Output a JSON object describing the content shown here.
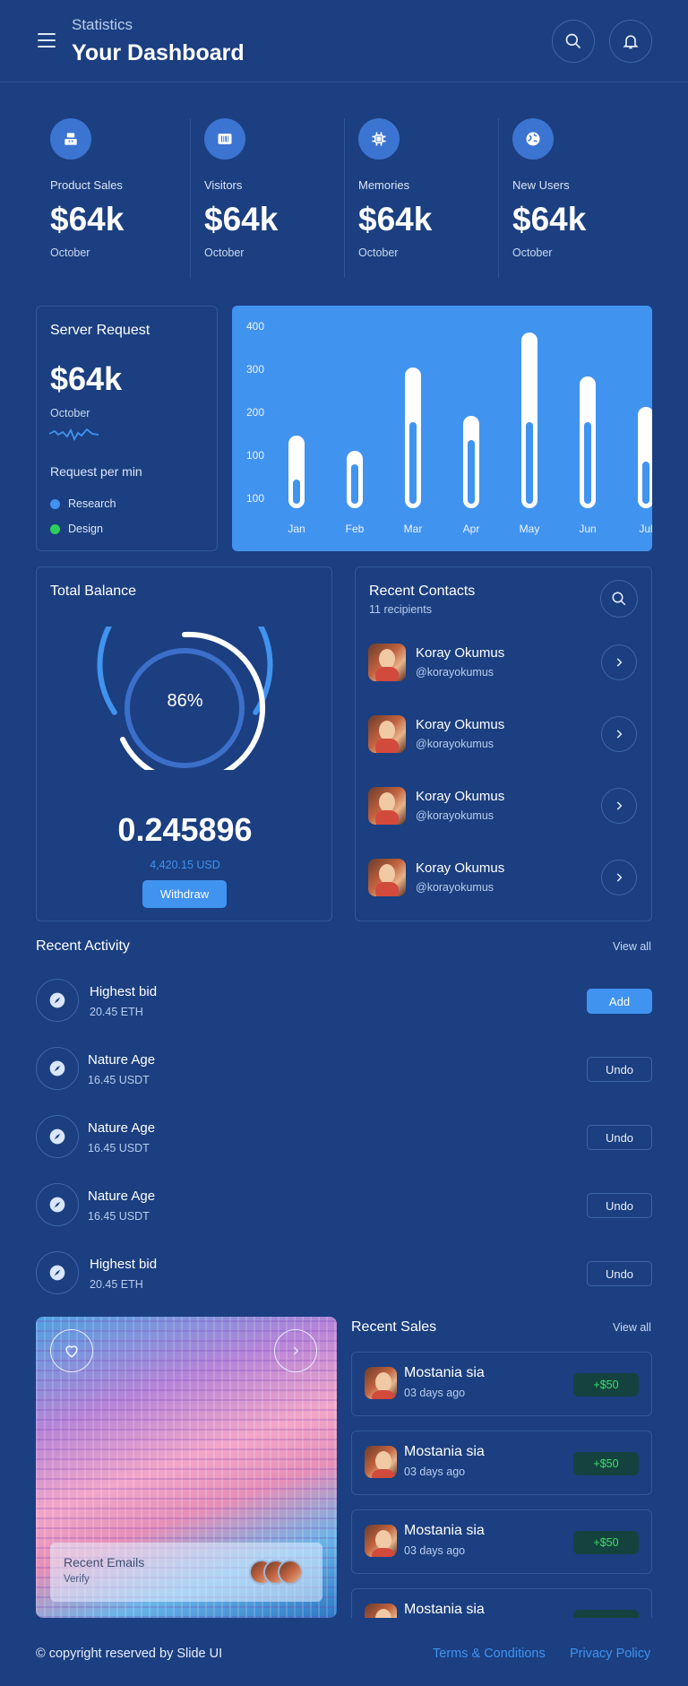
{
  "header": {
    "subtitle": "Statistics",
    "title": "Your Dashboard"
  },
  "stats": [
    {
      "label": "Product Sales",
      "value": "$64k",
      "period": "October",
      "icon": "cash-register-icon"
    },
    {
      "label": "Visitors",
      "value": "$64k",
      "period": "October",
      "icon": "barcode-icon"
    },
    {
      "label": "Memories",
      "value": "$64k",
      "period": "October",
      "icon": "chip-icon"
    },
    {
      "label": "New Users",
      "value": "$64k",
      "period": "October",
      "icon": "globe-icon"
    }
  ],
  "server": {
    "title": "Server Request",
    "value": "$64k",
    "period": "October",
    "subtitle": "Request per min",
    "legend": [
      {
        "label": "Research",
        "color": "#4193f0"
      },
      {
        "label": "Design",
        "color": "#2fcf5c"
      }
    ]
  },
  "chart_data": {
    "type": "bar",
    "categories": [
      "Jan",
      "Feb",
      "Mar",
      "Apr",
      "May",
      "Jun",
      "Jul"
    ],
    "series": [
      {
        "values": [
          165,
          130,
          320,
          210,
          400,
          300,
          230
        ]
      },
      {
        "values": [
          55,
          90,
          185,
          145,
          185,
          185,
          95
        ]
      }
    ],
    "y_tick_labels": [
      "400",
      "300",
      "200",
      "100",
      "100"
    ],
    "ylim": [
      0,
      400
    ],
    "bar_color": "#ffffff",
    "background": "#4193f0"
  },
  "balance": {
    "title": "Total Balance",
    "percent_label": "86%",
    "percent": 0.86,
    "amount": "0.245896",
    "usd": "4,420.15 USD",
    "button": "Withdraw"
  },
  "contacts": {
    "title": "Recent Contacts",
    "subtitle": "11 recipients",
    "items": [
      {
        "name": "Koray Okumus",
        "handle": "@korayokumus"
      },
      {
        "name": "Koray Okumus",
        "handle": "@korayokumus"
      },
      {
        "name": "Koray Okumus",
        "handle": "@korayokumus"
      },
      {
        "name": "Koray Okumus",
        "handle": "@korayokumus"
      }
    ]
  },
  "activity": {
    "title": "Recent Activity",
    "view_all": "View all",
    "items": [
      {
        "title": "Highest bid",
        "sub": "20.45 ETH",
        "action": "Add"
      },
      {
        "title": "Nature Age",
        "sub": "16.45 USDT",
        "action": "Undo"
      },
      {
        "title": "Nature Age",
        "sub": "16.45 USDT",
        "action": "Undo"
      },
      {
        "title": "Nature Age",
        "sub": "16.45 USDT",
        "action": "Undo"
      },
      {
        "title": "Highest bid",
        "sub": "20.45 ETH",
        "action": "Undo"
      }
    ]
  },
  "emails": {
    "title": "Recent Emails",
    "sub": "Verify"
  },
  "sales": {
    "title": "Recent Sales",
    "view_all": "View all",
    "items": [
      {
        "name": "Mostania sia",
        "date": "03 days ago",
        "amount": "+$50"
      },
      {
        "name": "Mostania sia",
        "date": "03 days ago",
        "amount": "+$50"
      },
      {
        "name": "Mostania sia",
        "date": "03 days ago",
        "amount": "+$50"
      },
      {
        "name": "Mostania sia",
        "date": "",
        "amount": ""
      }
    ]
  },
  "footer": {
    "copyright": "© copyright reserved by Slide UI",
    "terms": "Terms & Conditions",
    "privacy": "Privacy Policy"
  }
}
